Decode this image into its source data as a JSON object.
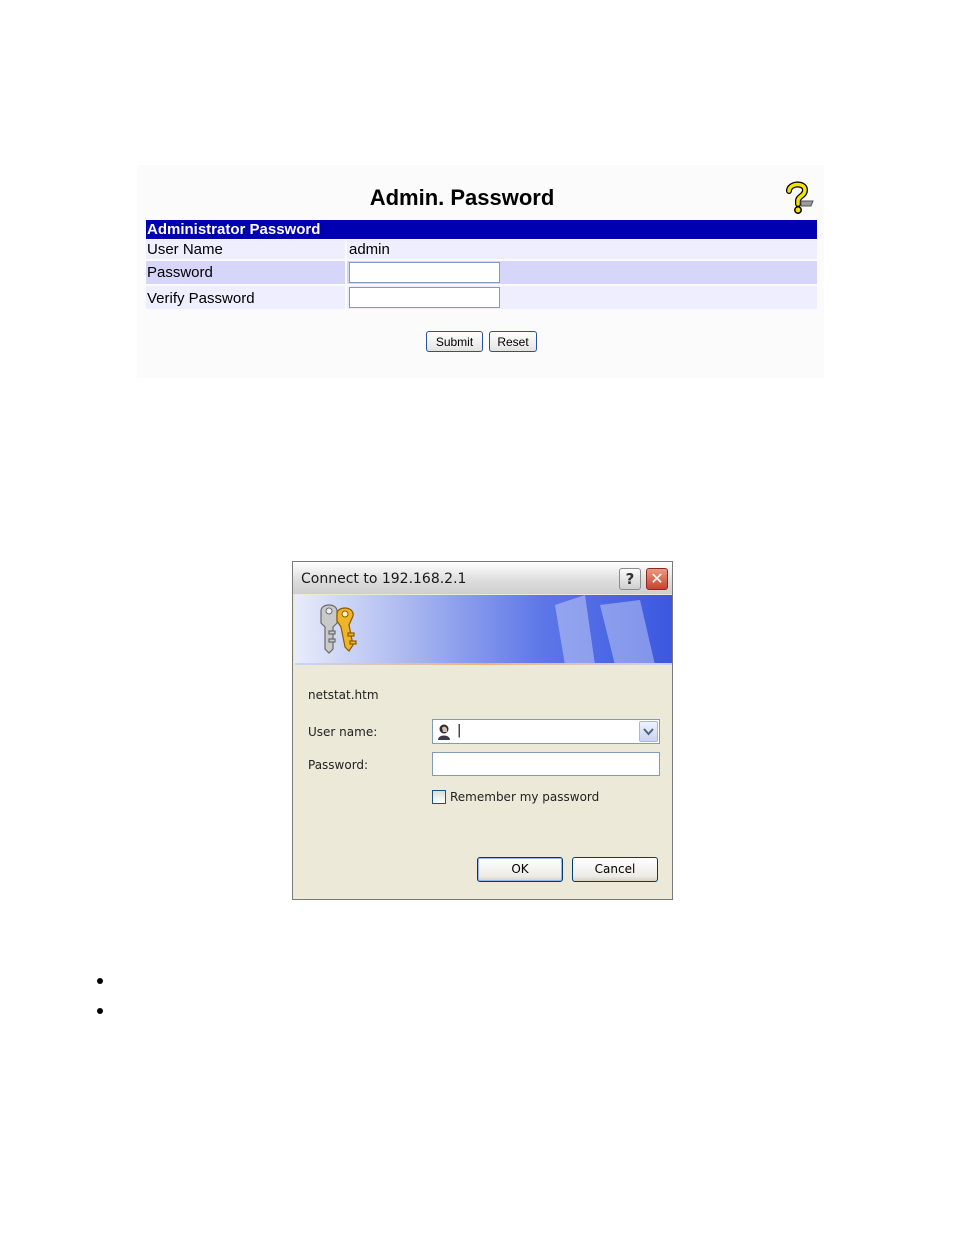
{
  "admin_panel": {
    "title": "Admin. Password",
    "section_header": "Administrator Password",
    "rows": [
      {
        "label": "User Name",
        "value": "admin"
      },
      {
        "label": "Password",
        "value": ""
      },
      {
        "label": "Verify Password",
        "value": ""
      }
    ],
    "submit_label": "Submit",
    "reset_label": "Reset",
    "header_color": "#0000b0",
    "row_color_light": "#eeeefe",
    "row_color_dark": "#d6d6fa"
  },
  "dialog": {
    "title": "Connect to 192.168.2.1",
    "help_glyph": "?",
    "close_glyph": "✕",
    "realm": "netstat.htm",
    "username_label": "User name:",
    "username_value": "|",
    "password_label": "Password:",
    "remember_label": "Remember my password",
    "remember_checked": false,
    "ok_label": "OK",
    "cancel_label": "Cancel"
  }
}
